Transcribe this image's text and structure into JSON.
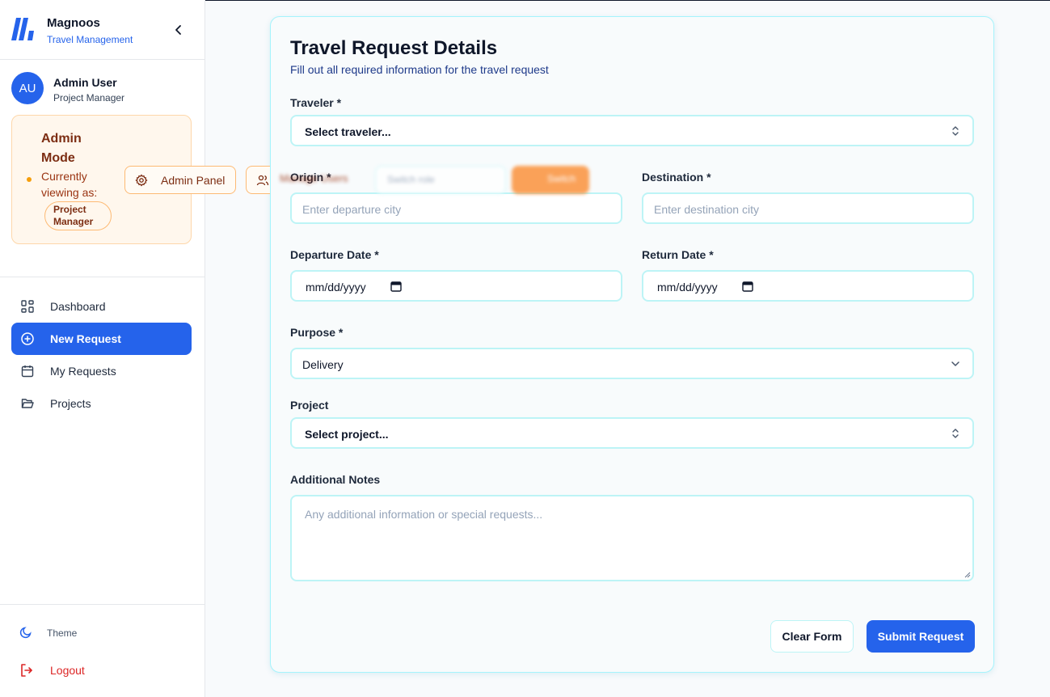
{
  "brand": {
    "name": "Magnoos",
    "subtitle": "Travel Management"
  },
  "user": {
    "initials": "AU",
    "name": "Admin User",
    "role": "Project Manager"
  },
  "admin_mode": {
    "title": "Admin Mode",
    "viewing_label": "Currently viewing as:",
    "role_pill": "Project Manager",
    "admin_panel_label": "Admin Panel",
    "manage_users_label": "Manage Users",
    "switch_role_label": "Switch role",
    "switch_button_label": "Switch"
  },
  "nav": {
    "items": [
      {
        "label": "Dashboard",
        "icon": "dashboard-grid-icon",
        "active": false
      },
      {
        "label": "New Request",
        "icon": "plus-circle-icon",
        "active": true
      },
      {
        "label": "My Requests",
        "icon": "calendar-icon",
        "active": false
      },
      {
        "label": "Projects",
        "icon": "folder-open-icon",
        "active": false
      }
    ]
  },
  "footer": {
    "theme_label": "Theme",
    "logout_label": "Logout"
  },
  "form": {
    "title": "Travel Request Details",
    "subtitle": "Fill out all required information for the travel request",
    "traveler": {
      "label": "Traveler *",
      "value": "Select traveler..."
    },
    "origin": {
      "label": "Origin *",
      "placeholder": "Enter departure city"
    },
    "destination": {
      "label": "Destination *",
      "placeholder": "Enter destination city"
    },
    "departure_date": {
      "label": "Departure Date *",
      "value": "mm/dd/yyyy"
    },
    "return_date": {
      "label": "Return Date *",
      "value": "mm/dd/yyyy"
    },
    "purpose": {
      "label": "Purpose *",
      "value": "Delivery"
    },
    "project": {
      "label": "Project",
      "value": "Select project..."
    },
    "notes": {
      "label": "Additional Notes",
      "placeholder": "Any additional information or special requests..."
    },
    "clear_label": "Clear Form",
    "submit_label": "Submit Request"
  },
  "colors": {
    "primary": "#2563eb",
    "accent_border": "#a5f3fc",
    "admin_bg": "#fff7ed",
    "admin_border": "#fdba74",
    "danger": "#dc2626"
  }
}
